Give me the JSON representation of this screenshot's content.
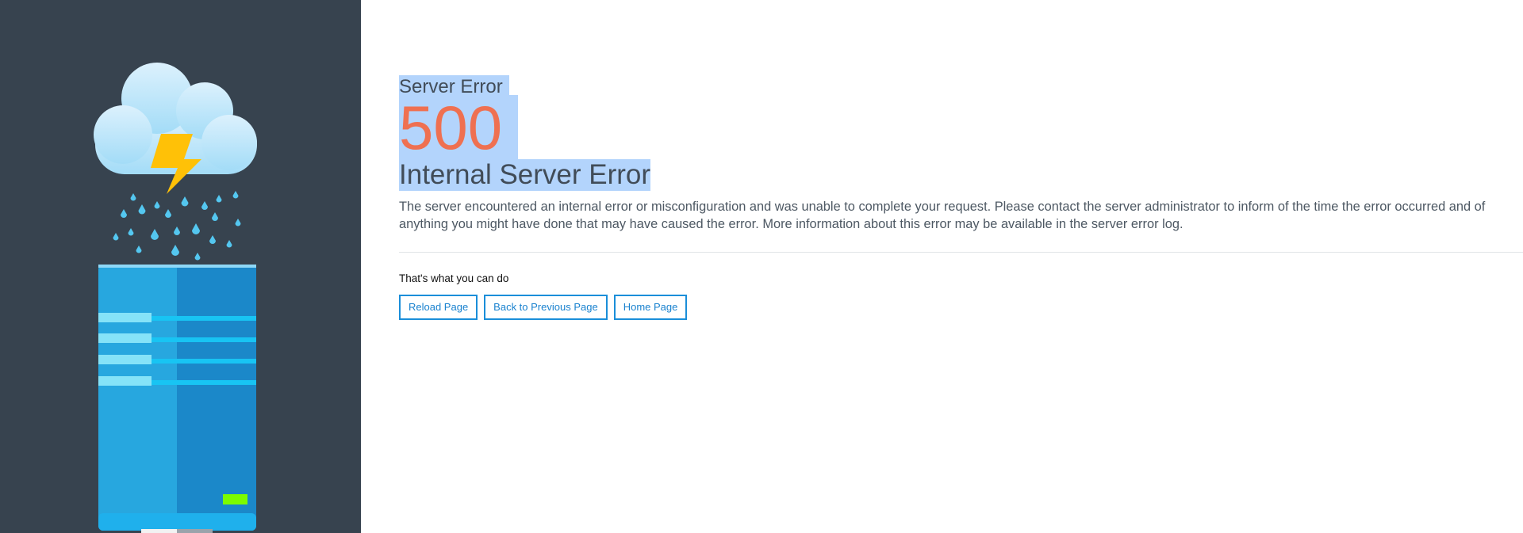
{
  "error": {
    "eyebrow": "Server Error",
    "code": "500",
    "title": "Internal Server Error",
    "message": "The server encountered an internal error or misconfiguration and was unable to complete your request. Please contact the server administrator to inform of the time the error occurred and of anything you might have done that may have caused the error. More information about this error may be available in the server error log."
  },
  "actions": {
    "label": "That's what you can do",
    "reload": "Reload Page",
    "back": "Back to Previous Page",
    "home": "Home Page"
  },
  "colors": {
    "sidebar_background": "#37434f",
    "error_code": "#ef7051",
    "button_accent": "#1a8ed9",
    "selection": "#b3d4fc",
    "status_led": "#7cfc00",
    "lightning": "#ffc107"
  },
  "illustration": {
    "icons": [
      "cloud-icon",
      "lightning-bolt-icon",
      "raindrops-icon",
      "server-tower-icon"
    ]
  }
}
